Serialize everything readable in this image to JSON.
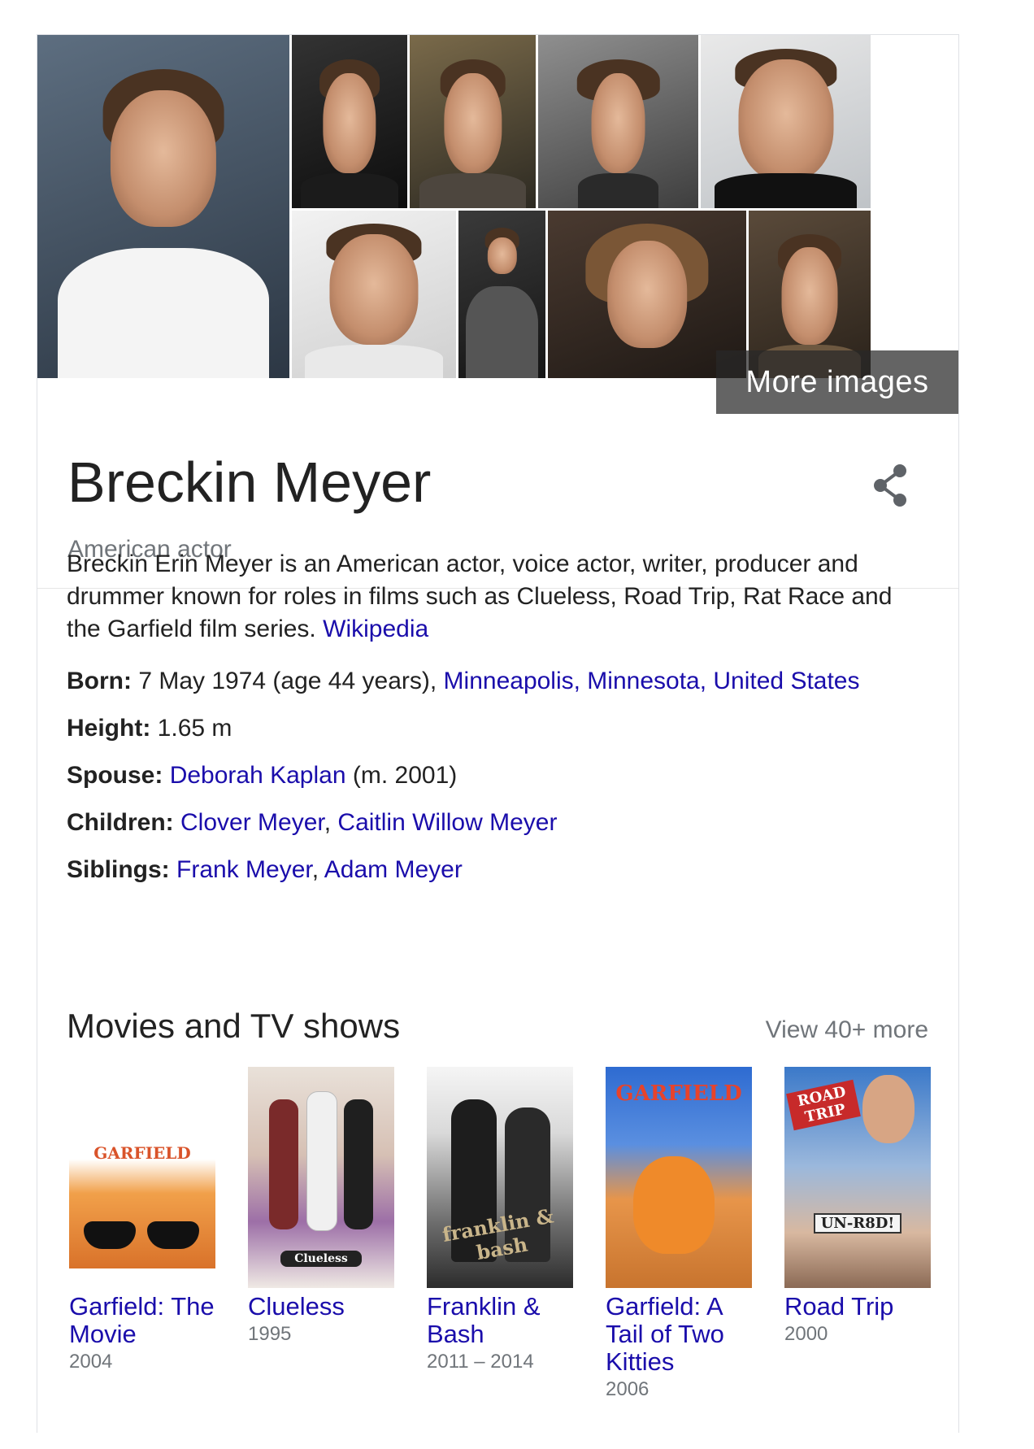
{
  "more_images_label": "More images",
  "name": "Breckin Meyer",
  "subtitle": "American actor",
  "description": {
    "text": "Breckin Erin Meyer is an American actor, voice actor, writer, producer and drummer known for roles in films such as Clueless, Road Trip, Rat Race and the Garfield film series.",
    "source": "Wikipedia"
  },
  "facts": {
    "born": {
      "label": "Born:",
      "value": "7 May 1974 (age 44 years),",
      "place": "Minneapolis, Minnesota, United States"
    },
    "height": {
      "label": "Height:",
      "value": "1.65 m"
    },
    "spouse": {
      "label": "Spouse:",
      "name": "Deborah Kaplan",
      "detail": "(m. 2001)"
    },
    "children": {
      "label": "Children:",
      "first": "Clover Meyer",
      "second": "Caitlin Willow Meyer"
    },
    "siblings": {
      "label": "Siblings:",
      "first": "Frank Meyer",
      "second": "Adam Meyer"
    }
  },
  "movies": {
    "heading": "Movies and TV shows",
    "view_more": "View 40+ more",
    "items": [
      {
        "title": "Garfield: The Movie",
        "year": "2004",
        "poster_text": "GARFIELD"
      },
      {
        "title": "Clueless",
        "year": "1995",
        "poster_text": "Clueless"
      },
      {
        "title": "Franklin & Bash",
        "year": "2011 – 2014",
        "poster_text": "franklin & bash"
      },
      {
        "title": "Garfield: A Tail of Two Kitties",
        "year": "2006",
        "poster_text": "GARFIELD"
      },
      {
        "title": "Road Trip",
        "year": "2000",
        "poster_text": "ROAD TRIP"
      }
    ]
  },
  "poster_text_extra": {
    "road_trip_sign": "UN-R8D!"
  },
  "icons": {
    "share": "share-icon"
  },
  "colors": {
    "link": "#1a0dab",
    "muted": "#70757a",
    "text": "#222222"
  }
}
